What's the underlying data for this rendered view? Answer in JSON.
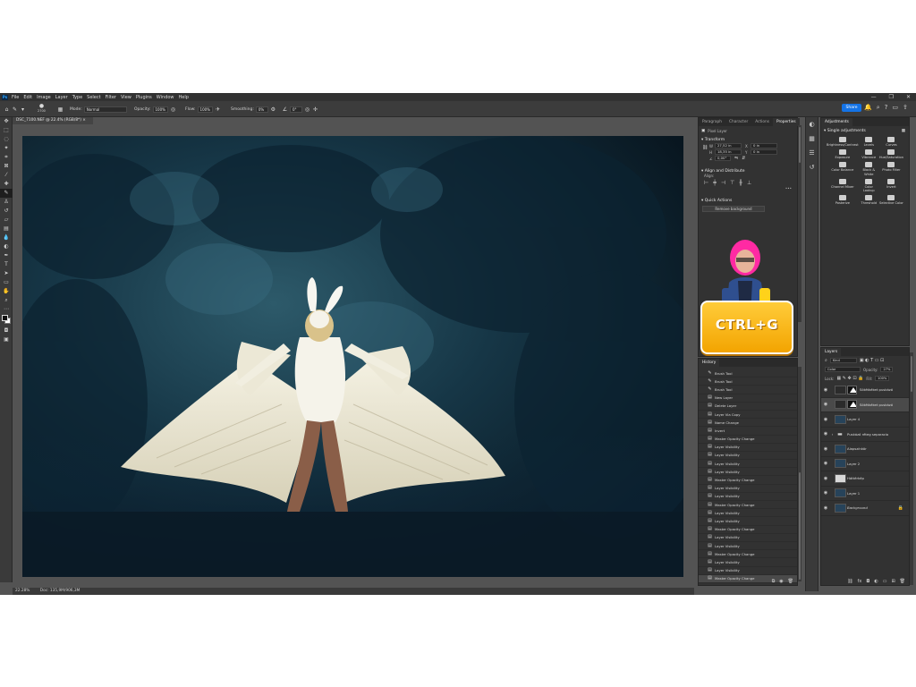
{
  "menubar": {
    "app_icon": "Ps",
    "items": [
      "File",
      "Edit",
      "Image",
      "Layer",
      "Type",
      "Select",
      "Filter",
      "View",
      "Plugins",
      "Window",
      "Help"
    ],
    "window_controls": [
      "—",
      "❐",
      "✕"
    ]
  },
  "options_bar": {
    "brush_size": "2700",
    "mode_label": "Mode:",
    "mode_value": "Normal",
    "opacity_label": "Opacity:",
    "opacity_value": "100%",
    "flow_label": "Flow:",
    "flow_value": "100%",
    "smoothing_label": "Smoothing:",
    "smoothing_value": "0%",
    "angle_value": "0°",
    "share_label": "Share"
  },
  "document": {
    "tab_title": "DSC_7100.NEF @ 22.4% (RGB/8*) ×"
  },
  "statusbar": {
    "zoom": "22.28%",
    "doc_info": "Doc: 135,9M/906,3M"
  },
  "properties_panel": {
    "tabs": [
      "Paragraph",
      "Character",
      "Actions",
      "Properties"
    ],
    "active_tab": "Properties",
    "layer_type": "Pixel Layer",
    "transform_title": "Transform",
    "w_label": "W",
    "w_value": "27,52 in",
    "x_label": "X",
    "x_value": "0 in",
    "h_label": "H",
    "h_value": "18,35 in",
    "y_label": "Y",
    "y_value": "0 in",
    "angle_value": "0,00°",
    "align_title": "Align and Distribute",
    "align_label": "Align:",
    "quick_actions_title": "Quick Actions",
    "quick_action_button": "Remove background"
  },
  "history_panel": {
    "title": "History",
    "items": [
      {
        "label": "Brush Tool",
        "icon": "brush-icon"
      },
      {
        "label": "Brush Tool",
        "icon": "brush-icon"
      },
      {
        "label": "Brush Tool",
        "icon": "brush-icon"
      },
      {
        "label": "New Layer",
        "icon": "history-state-icon"
      },
      {
        "label": "Delete Layer",
        "icon": "history-state-icon"
      },
      {
        "label": "Layer Via Copy",
        "icon": "history-state-icon"
      },
      {
        "label": "Name Change",
        "icon": "history-state-icon"
      },
      {
        "label": "Invert",
        "icon": "history-state-icon"
      },
      {
        "label": "Master Opacity Change",
        "icon": "history-state-icon"
      },
      {
        "label": "Layer Visibility",
        "icon": "history-state-icon"
      },
      {
        "label": "Layer Visibility",
        "icon": "history-state-icon"
      },
      {
        "label": "Layer Visibility",
        "icon": "history-state-icon"
      },
      {
        "label": "Layer Visibility",
        "icon": "history-state-icon"
      },
      {
        "label": "Master Opacity Change",
        "icon": "history-state-icon"
      },
      {
        "label": "Layer Visibility",
        "icon": "history-state-icon"
      },
      {
        "label": "Layer Visibility",
        "icon": "history-state-icon"
      },
      {
        "label": "Master Opacity Change",
        "icon": "history-state-icon"
      },
      {
        "label": "Layer Visibility",
        "icon": "history-state-icon"
      },
      {
        "label": "Layer Visibility",
        "icon": "history-state-icon"
      },
      {
        "label": "Master Opacity Change",
        "icon": "history-state-icon"
      },
      {
        "label": "Layer Visibility",
        "icon": "history-state-icon"
      },
      {
        "label": "Layer Visibility",
        "icon": "history-state-icon"
      },
      {
        "label": "Master Opacity Change",
        "icon": "history-state-icon"
      },
      {
        "label": "Layer Visibility",
        "icon": "history-state-icon"
      },
      {
        "label": "Layer Visibility",
        "icon": "history-state-icon"
      },
      {
        "label": "Master Opacity Change",
        "icon": "history-state-icon"
      }
    ]
  },
  "overlay": {
    "shortcut_badge": "CTRL+G",
    "badge_color": "#ffb81c",
    "presenter_hair_color": "#ff2aa3"
  },
  "adjustments_panel": {
    "title": "Adjustments",
    "section": "Single adjustments",
    "items": [
      "Brightness/Contrast",
      "Levels",
      "Curves",
      "Exposure",
      "Vibrance",
      "Hue/Saturation",
      "Color Balance",
      "Black & White",
      "Photo Filter",
      "Channel Mixer",
      "Color Lookup",
      "Invert",
      "Posterize",
      "Threshold",
      "Selective Color"
    ]
  },
  "layers_panel": {
    "title": "Layers",
    "kind_filter": "Kind",
    "blend_mode": "Color",
    "opacity_label": "Opacity:",
    "opacity_value": "27%",
    "lock_label": "Lock:",
    "fill_label": "Fill:",
    "fill_value": "100%",
    "layers": [
      {
        "name": "Sötétkéket puskázó",
        "type": "adjustment",
        "selected": false
      },
      {
        "name": "Sötétkéket puskázó",
        "type": "adjustment",
        "selected": true
      },
      {
        "name": "Layer 4",
        "type": "pixel",
        "selected": false
      },
      {
        "name": "Puskázó réteg separacio",
        "type": "group",
        "selected": false
      },
      {
        "name": "Alapszínkör",
        "type": "pixel",
        "selected": false
      },
      {
        "name": "Layer 2",
        "type": "pixel",
        "selected": false
      },
      {
        "name": "Háttérkép",
        "type": "pixel-light",
        "selected": false
      },
      {
        "name": "Layer 1",
        "type": "pixel",
        "selected": false
      },
      {
        "name": "Background",
        "type": "background",
        "selected": false
      }
    ]
  },
  "colors": {
    "accent": "#1473e6",
    "panel_bg": "#323232",
    "app_bg": "#535353"
  }
}
